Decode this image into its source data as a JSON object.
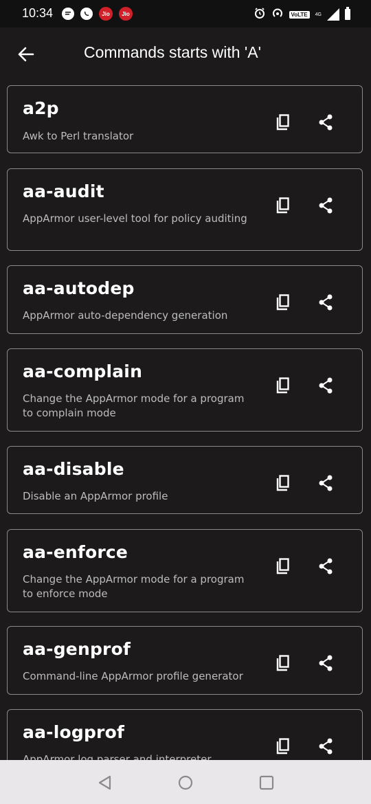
{
  "status_bar": {
    "time": "10:34",
    "left_icons": [
      "message-bubble-icon",
      "whatsapp-icon",
      "jio-icon",
      "jio-icon"
    ],
    "jio_label": "Jio",
    "volte_label": "VoLTE",
    "network_label": "4G",
    "right_icons": [
      "alarm-icon",
      "hotspot-icon",
      "volte-icon",
      "signal-icon",
      "battery-icon"
    ]
  },
  "app_bar": {
    "title": "Commands starts with 'A'",
    "back_icon": "arrow-left-icon"
  },
  "commands": [
    {
      "name": "a2p",
      "description": "Awk to Perl translator"
    },
    {
      "name": "aa-audit",
      "description": "AppArmor user-level tool for policy auditing"
    },
    {
      "name": "aa-autodep",
      "description": "AppArmor auto-dependency generation"
    },
    {
      "name": "aa-complain",
      "description": "Change the AppArmor mode for a program to complain mode"
    },
    {
      "name": "aa-disable",
      "description": "Disable an AppArmor profile"
    },
    {
      "name": "aa-enforce",
      "description": "Change the AppArmor mode for a program to enforce mode"
    },
    {
      "name": "aa-genprof",
      "description": "Command-line AppArmor profile generator"
    },
    {
      "name": "aa-logprof",
      "description": "AppArmor log parser and interpreter"
    }
  ],
  "actions": {
    "copy_icon": "copy-icon",
    "share_icon": "share-icon"
  },
  "nav_bar": {
    "buttons": [
      "back-triangle-icon",
      "home-circle-icon",
      "recents-square-icon"
    ]
  },
  "colors": {
    "background": "#1c1a1a",
    "card_border": "#8a8a8a",
    "description": "#bdbdbd",
    "nav_bar": "#e9e7ea"
  }
}
